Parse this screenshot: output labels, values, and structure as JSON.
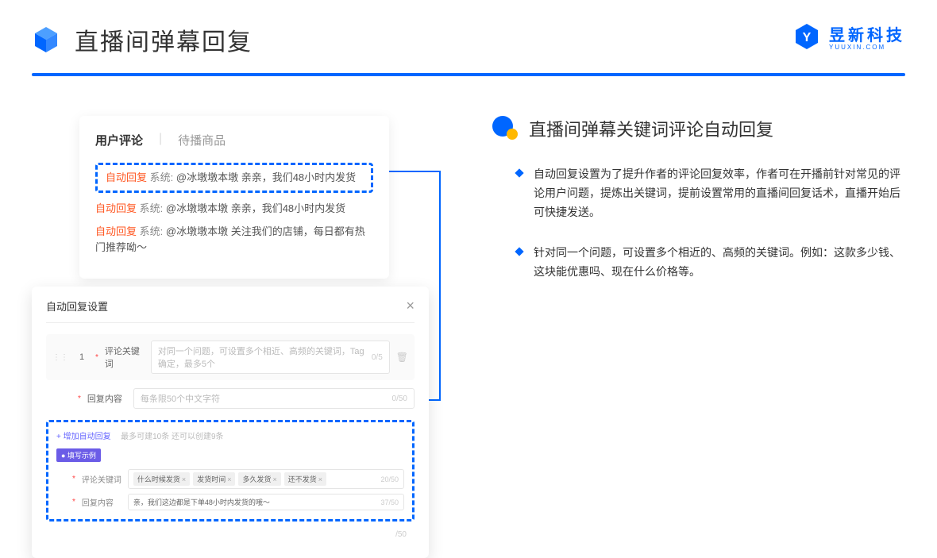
{
  "header": {
    "title": "直播间弹幕回复"
  },
  "brand": {
    "name": "昱新科技",
    "sub": "YUUXIN.COM"
  },
  "card1": {
    "tab1": "用户评论",
    "tab2": "待播商品",
    "line1_tag": "自动回复",
    "line1_sys": "系统:",
    "line1_txt": "@冰墩墩本墩 亲亲，我们48小时内发货",
    "line2_tag": "自动回复",
    "line2_sys": "系统:",
    "line2_txt": "@冰墩墩本墩 亲亲，我们48小时内发货",
    "line3_tag": "自动回复",
    "line3_sys": "系统:",
    "line3_txt": "@冰墩墩本墩 关注我们的店铺，每日都有热门推荐呦～"
  },
  "card2": {
    "title": "自动回复设置",
    "seq": "1",
    "label1": "评论关键词",
    "placeholder1": "对同一个问题，可设置多个相近、高频的关键词，Tag确定，最多5个",
    "count1": "0/5",
    "label2": "回复内容",
    "placeholder2": "每条限50个中文字符",
    "count2": "0/50",
    "add": "+ 增加自动回复",
    "hint": "最多可建10条 还可以创建9条",
    "badge": "● 填写示例",
    "ex_label1": "评论关键词",
    "ex_count1": "20/50",
    "ex_tag1": "什么时候发货",
    "ex_tag2": "发货时间",
    "ex_tag3": "多久发货",
    "ex_tag4": "还不发货",
    "ex_label2": "回复内容",
    "ex_val2": "亲，我们这边都是下单48小时内发货的哦～",
    "ex_count2": "37/50",
    "bottom_count": "/50"
  },
  "section": {
    "title": "直播间弹幕关键词评论自动回复",
    "b1": "自动回复设置为了提升作者的评论回复效率，作者可在开播前针对常见的评论用户问题，提炼出关键词，提前设置常用的直播间回复话术，直播开始后可快捷发送。",
    "b2": "针对同一个问题，可设置多个相近的、高频的关键词。例如：这款多少钱、这块能优惠吗、现在什么价格等。"
  }
}
